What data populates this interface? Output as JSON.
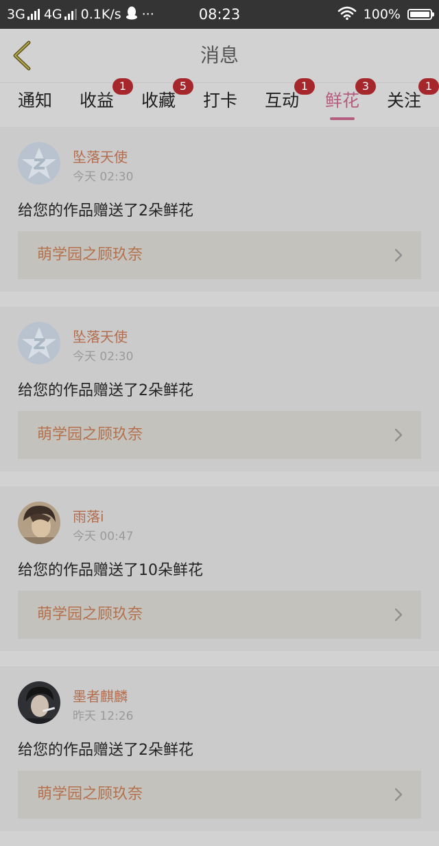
{
  "status_bar": {
    "net1": "3G",
    "net2": "4G",
    "speed": "0.1K/s",
    "more": "···",
    "time": "08:23",
    "battery_text": "100%",
    "battery_level": 1.0,
    "icons": [
      "signal-icon",
      "qq-icon",
      "wifi-icon",
      "battery-icon"
    ]
  },
  "header": {
    "title": "消息",
    "back_icon": "back-chevron-icon"
  },
  "tabs": [
    {
      "label": "通知",
      "badge": ""
    },
    {
      "label": "收益",
      "badge": "1"
    },
    {
      "label": "收藏",
      "badge": "5"
    },
    {
      "label": "打卡",
      "badge": ""
    },
    {
      "label": "互动",
      "badge": "1"
    },
    {
      "label": "鲜花",
      "badge": "3",
      "active": true
    },
    {
      "label": "关注",
      "badge": "1"
    }
  ],
  "items": [
    {
      "user": "坠落天使",
      "time": "今天 02:30",
      "message": "给您的作品赠送了2朵鲜花",
      "work": "萌学园之顾玖奈",
      "avatar": "default-avatar"
    },
    {
      "user": "坠落天使",
      "time": "今天 02:30",
      "message": "给您的作品赠送了2朵鲜花",
      "work": "萌学园之顾玖奈",
      "avatar": "default-avatar"
    },
    {
      "user": "雨落i",
      "time": "今天 00:47",
      "message": "给您的作品赠送了10朵鲜花",
      "work": "萌学园之顾玖奈",
      "avatar": "photo-avatar"
    },
    {
      "user": "墨者麒麟",
      "time": "昨天 12:26",
      "message": "给您的作品赠送了2朵鲜花",
      "work": "萌学园之顾玖奈",
      "avatar": "photo-avatar"
    }
  ],
  "colors": {
    "accent": "#b55d7e",
    "badge": "#a5262b",
    "username": "#b36e4f",
    "overlay_background": "#d2d2d2"
  }
}
